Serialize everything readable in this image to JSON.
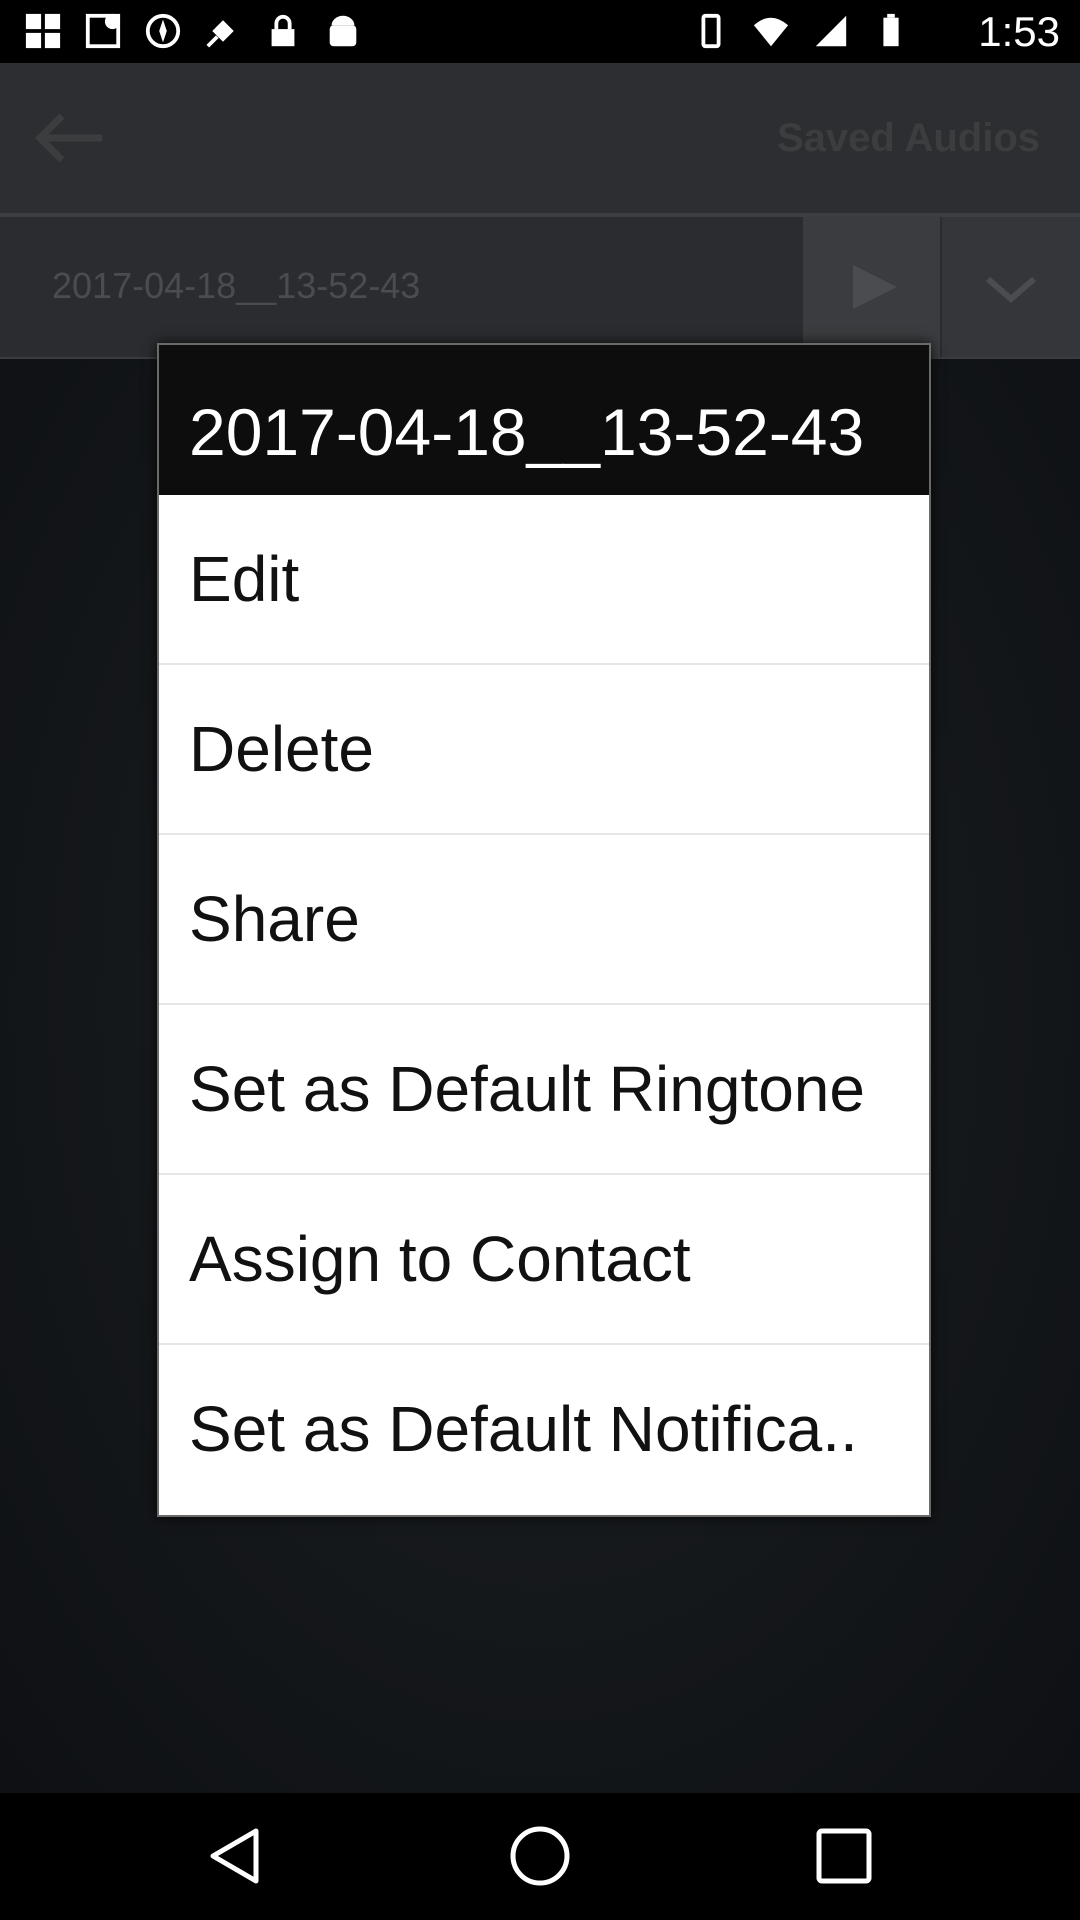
{
  "status_bar": {
    "time": "1:53",
    "icons": [
      "grid-icon",
      "notification-icon",
      "compass-icon",
      "gps-icon",
      "lock-icon",
      "android-icon"
    ]
  },
  "app_bar": {
    "title": "Saved Audios"
  },
  "list": {
    "items": [
      {
        "name": "2017-04-18__13-52-43"
      }
    ]
  },
  "dialog": {
    "title": "2017-04-18__13-52-43",
    "options": [
      {
        "label": "Edit"
      },
      {
        "label": "Delete"
      },
      {
        "label": "Share"
      },
      {
        "label": "Set as Default Ringtone"
      },
      {
        "label": "Assign to Contact"
      },
      {
        "label": "Set as Default Notifica.."
      }
    ]
  },
  "navigation": {
    "buttons": [
      "back-icon",
      "home-icon",
      "recents-icon"
    ]
  }
}
